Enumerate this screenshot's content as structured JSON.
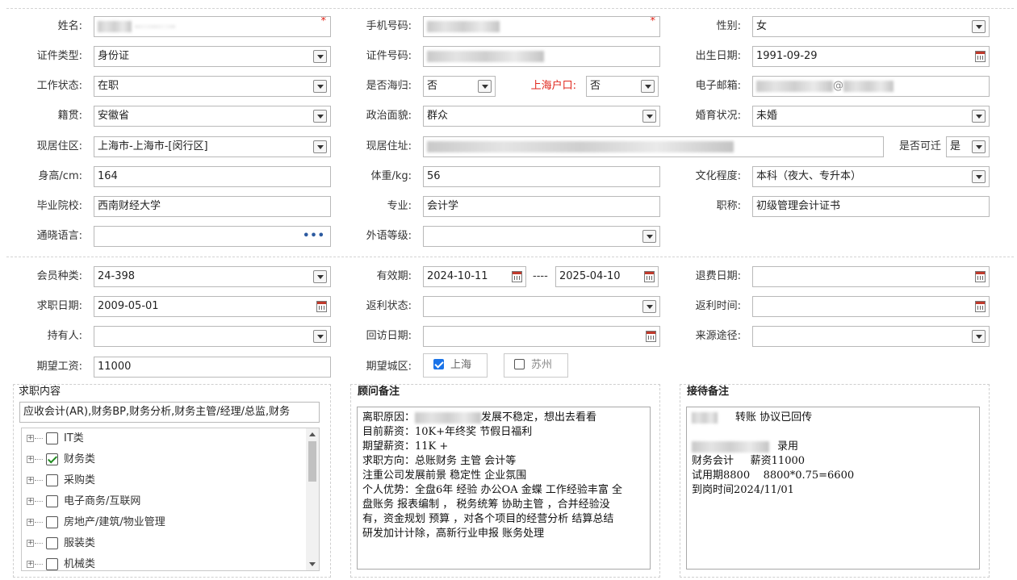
{
  "section1": {
    "name": {
      "label": "姓名:"
    },
    "mobile": {
      "label": "手机号码:"
    },
    "gender": {
      "label": "性别:",
      "value": "女"
    },
    "id_type": {
      "label": "证件类型:",
      "value": "身份证"
    },
    "id_no": {
      "label": "证件号码:"
    },
    "birth": {
      "label": "出生日期:",
      "value": "1991-09-29"
    },
    "work_status": {
      "label": "工作状态:",
      "value": "在职"
    },
    "returnee": {
      "label": "是否海归:",
      "value": "否"
    },
    "sh_hukou": {
      "label": "上海户口:",
      "value": "否"
    },
    "email": {
      "label": "电子邮箱:",
      "value_visible": "@"
    },
    "native": {
      "label": "籍贯:",
      "value": "安徽省"
    },
    "politics": {
      "label": "政治面貌:",
      "value": "群众"
    },
    "marital": {
      "label": "婚育状况:",
      "value": "未婚"
    },
    "residence_area": {
      "label": "现居住区:",
      "value": "上海市-上海市-[闵行区]"
    },
    "residence_addr": {
      "label": "现居住址:"
    },
    "relocatable": {
      "label": "是否可迁",
      "value": "是"
    },
    "height": {
      "label": "身高/cm:",
      "value": "164"
    },
    "weight": {
      "label": "体重/kg:",
      "value": "56"
    },
    "education": {
      "label": "文化程度:",
      "value": "本科（夜大、专升本）"
    },
    "school": {
      "label": "毕业院校:",
      "value": "西南财经大学"
    },
    "major": {
      "label": "专业:",
      "value": "会计学"
    },
    "title": {
      "label": "职称:",
      "value": "初级管理会计证书"
    },
    "languages": {
      "label": "通晓语言:",
      "value": "",
      "more": "•••"
    },
    "foreign_level": {
      "label": "外语等级:",
      "value": ""
    }
  },
  "section2": {
    "member_type": {
      "label": "会员种类:",
      "value": "24-398"
    },
    "validity": {
      "label": "有效期:",
      "from": "2024-10-11",
      "sep": "----",
      "to": "2025-04-10"
    },
    "refund_date": {
      "label": "退费日期:",
      "value": ""
    },
    "job_date": {
      "label": "求职日期:",
      "value": "2009-05-01"
    },
    "rebate_status": {
      "label": "返利状态:",
      "value": ""
    },
    "rebate_time": {
      "label": "返利时间:",
      "value": ""
    },
    "holder": {
      "label": "持有人:",
      "value": ""
    },
    "visit_date": {
      "label": "回访日期:",
      "value": ""
    },
    "source": {
      "label": "来源途径:",
      "value": ""
    },
    "expected_salary": {
      "label": "期望工资:",
      "value": "11000"
    },
    "expected_city": {
      "label": "期望城区:",
      "options": [
        {
          "label": "上海",
          "checked": true
        },
        {
          "label": "苏州",
          "checked": false
        }
      ]
    }
  },
  "job_content": {
    "title": "求职内容",
    "summary": "应收会计(AR),财务BP,财务分析,财务主管/经理/总监,财务",
    "tree": [
      {
        "label": "IT类",
        "checked": false
      },
      {
        "label": "财务类",
        "checked": true
      },
      {
        "label": "采购类",
        "checked": false
      },
      {
        "label": "电子商务/互联网",
        "checked": false
      },
      {
        "label": "房地产/建筑/物业管理",
        "checked": false
      },
      {
        "label": "服装类",
        "checked": false
      },
      {
        "label": "机械类",
        "checked": false
      }
    ]
  },
  "consultant_notes": {
    "title": "顾问备注",
    "lines": [
      "离职原因：发展不稳定，想出去看看",
      "目前薪资：10K+年终奖 节假日福利",
      "期望薪资：11K +",
      "求职方向：总账财务 主管  会计等",
      "注重公司发展前景  稳定性 企业氛围",
      "个人优势：全盘6年 经验 办公OA 金蝶 工作经验丰富 全",
      "盘账务 报表编制 ， 税务统筹 协助主管 ，合并经验没",
      "有，资金规划 预算 ，对各个项目的经营分析  结算总结",
      "研发加计计除，高新行业申报 账务处理"
    ]
  },
  "reception_notes": {
    "title": "接待备注",
    "lines": [
      "转账  协议已回传",
      "",
      "录用",
      "财务会计     薪资11000",
      "试用期8800    8800*0.75=6600",
      "到岗时间2024/11/01"
    ]
  },
  "colors": {
    "required": "#e0261b",
    "accent": "#1a73e8",
    "check_green": "#1e8a1e"
  }
}
